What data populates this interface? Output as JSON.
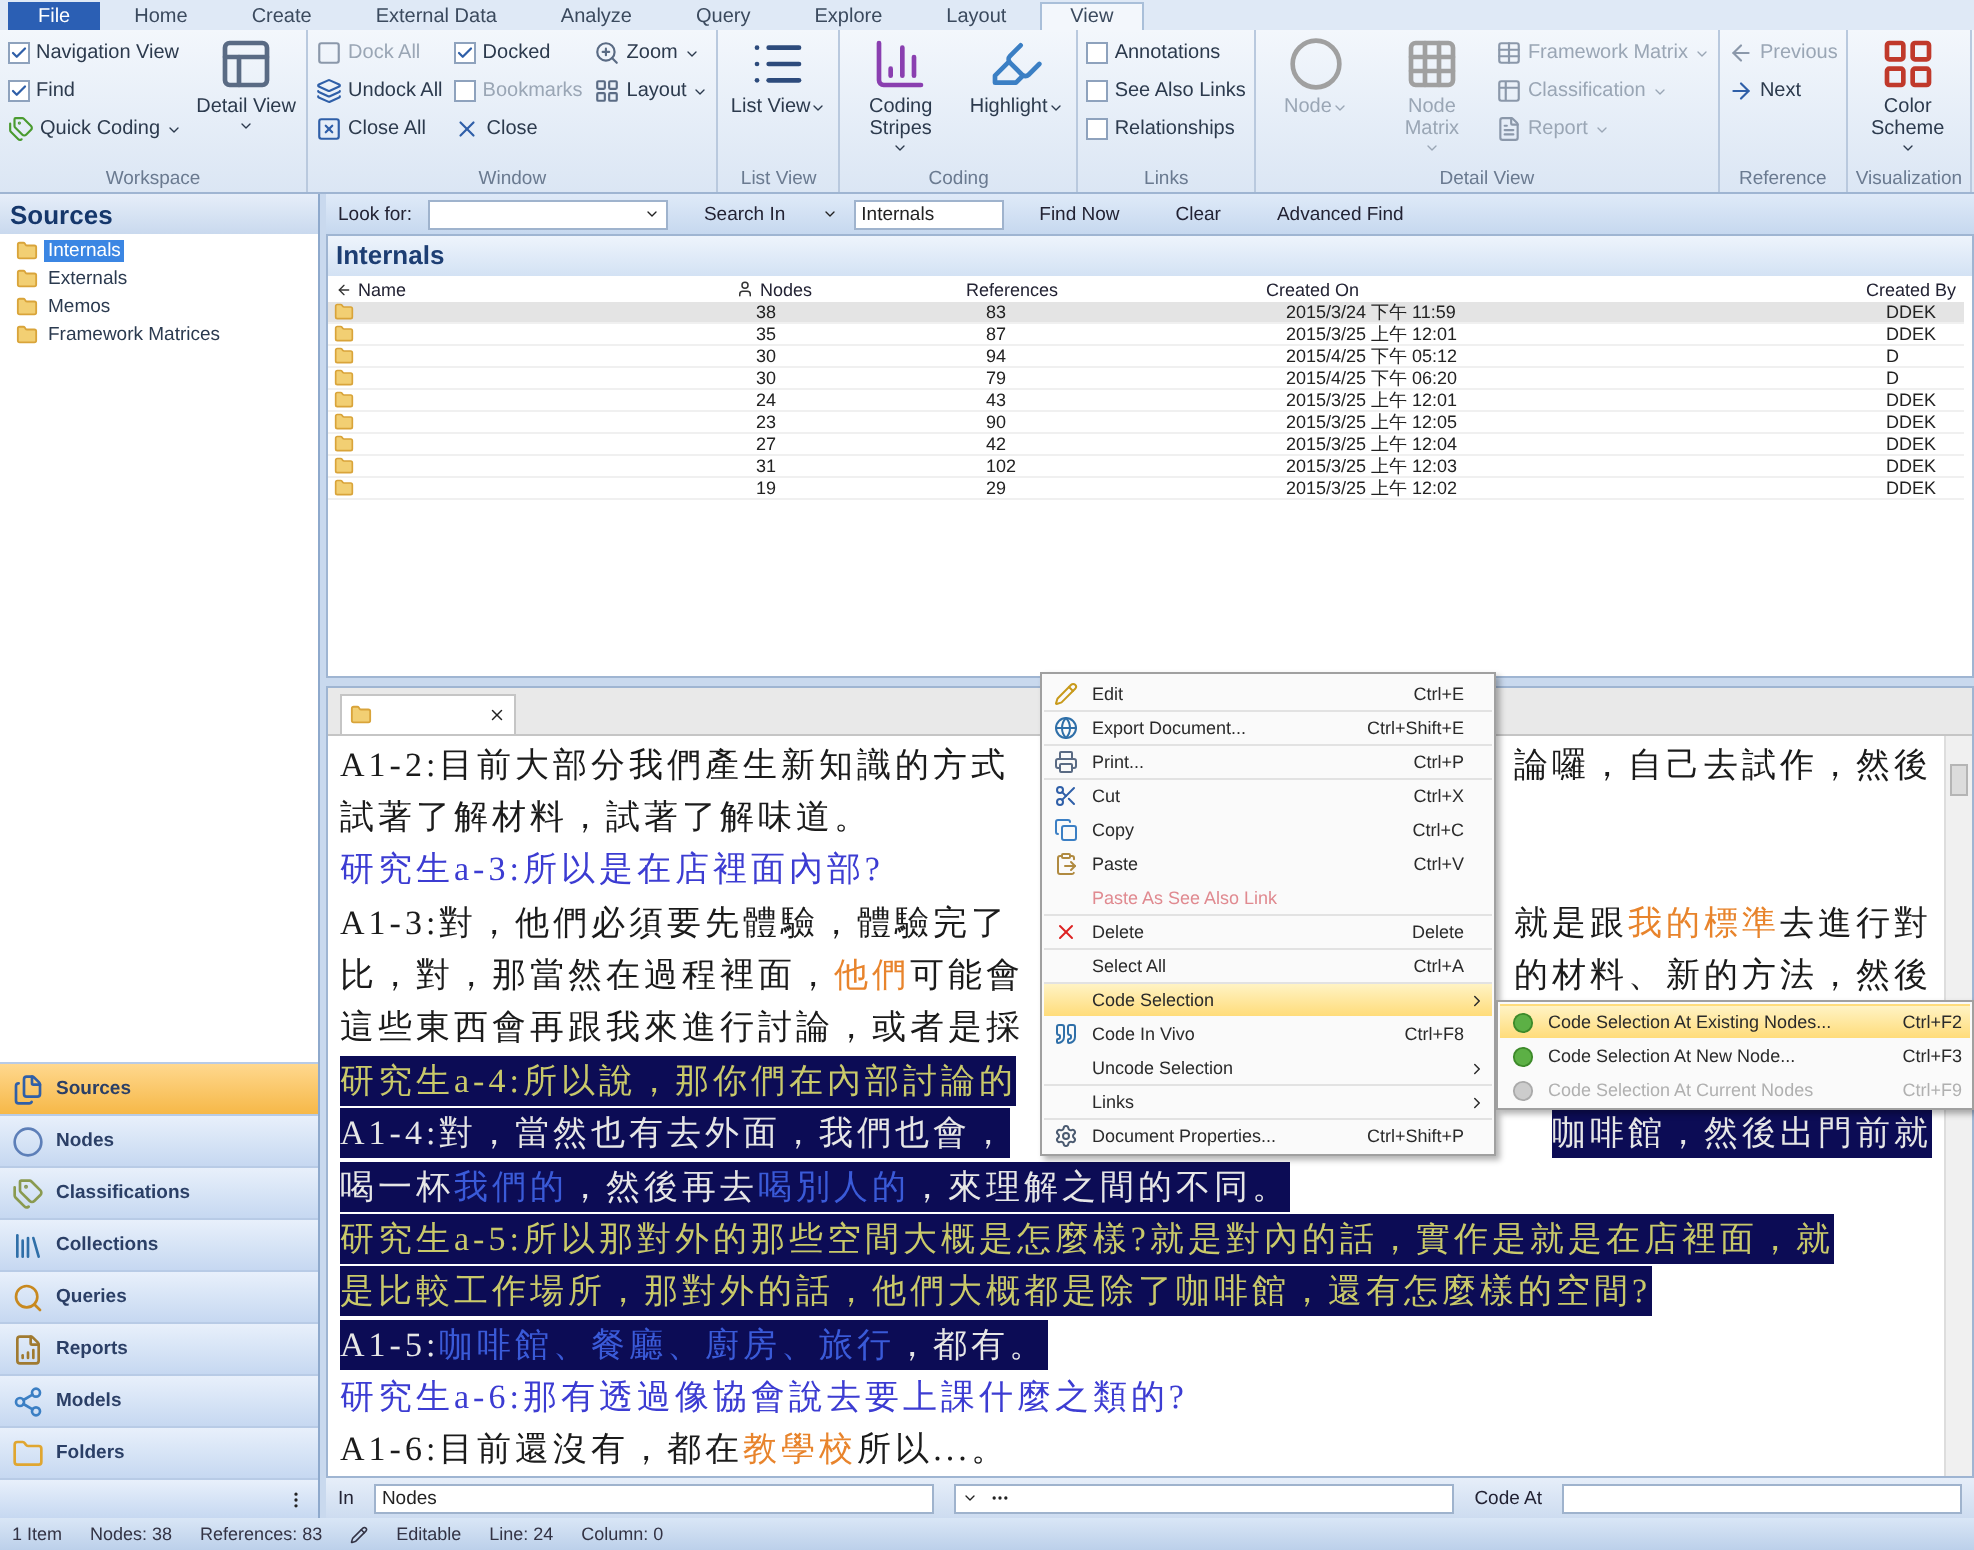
{
  "ribbon": {
    "tabs": [
      {
        "label": "File",
        "kind": "file",
        "selected": false
      },
      {
        "label": "Home",
        "kind": "tab",
        "selected": false
      },
      {
        "label": "Create",
        "kind": "tab",
        "selected": false
      },
      {
        "label": "External Data",
        "kind": "tab",
        "selected": false
      },
      {
        "label": "Analyze",
        "kind": "tab",
        "selected": false
      },
      {
        "label": "Query",
        "kind": "tab",
        "selected": false
      },
      {
        "label": "Explore",
        "kind": "tab",
        "selected": false
      },
      {
        "label": "Layout",
        "kind": "tab",
        "selected": false
      },
      {
        "label": "View",
        "kind": "tab",
        "selected": true
      }
    ],
    "groups": [
      {
        "label": "Workspace",
        "columns": [
          [
            {
              "kind": "check",
              "label": "Navigation View",
              "checked": true,
              "disabled": false
            },
            {
              "kind": "check",
              "label": "Find",
              "checked": true,
              "disabled": false
            },
            {
              "kind": "small",
              "label": "Quick Coding",
              "dropdown": true,
              "disabled": false
            }
          ],
          [
            {
              "kind": "large",
              "label": "Detail View",
              "dropdown": true,
              "disabled": false
            }
          ]
        ]
      },
      {
        "label": "Window",
        "columns": [
          [
            {
              "kind": "small",
              "label": "Dock All",
              "dropdown": false,
              "disabled": true
            },
            {
              "kind": "small",
              "label": "Undock All",
              "dropdown": false,
              "disabled": false
            },
            {
              "kind": "small",
              "label": "Close All",
              "dropdown": false,
              "disabled": false
            }
          ],
          [
            {
              "kind": "check",
              "label": "Docked",
              "checked": true,
              "disabled": false
            },
            {
              "kind": "check",
              "label": "Bookmarks",
              "checked": false,
              "disabled": true
            },
            {
              "kind": "small",
              "label": "Close",
              "dropdown": false,
              "disabled": false
            }
          ],
          [
            {
              "kind": "small",
              "label": "Zoom",
              "dropdown": true,
              "disabled": false
            },
            {
              "kind": "small",
              "label": "Layout",
              "dropdown": true,
              "disabled": false
            }
          ]
        ]
      },
      {
        "label": "List View",
        "columns": [
          [
            {
              "kind": "large",
              "label": "List View",
              "dropdown": true,
              "disabled": false
            }
          ]
        ]
      },
      {
        "label": "Coding",
        "columns": [
          [
            {
              "kind": "large",
              "label": "Coding Stripes",
              "dropdown": true,
              "disabled": false
            }
          ],
          [
            {
              "kind": "large",
              "label": "Highlight",
              "dropdown": true,
              "disabled": false
            }
          ]
        ]
      },
      {
        "label": "Links",
        "columns": [
          [
            {
              "kind": "check",
              "label": "Annotations",
              "checked": false,
              "disabled": false
            },
            {
              "kind": "check",
              "label": "See Also Links",
              "checked": false,
              "disabled": false
            },
            {
              "kind": "check",
              "label": "Relationships",
              "checked": false,
              "disabled": false
            }
          ]
        ]
      },
      {
        "label": "Detail View",
        "columns": [
          [
            {
              "kind": "large",
              "label": "Node",
              "dropdown": true,
              "disabled": true
            }
          ],
          [
            {
              "kind": "large",
              "label": "Node Matrix",
              "dropdown": true,
              "disabled": true
            }
          ],
          [
            {
              "kind": "small",
              "label": "Framework Matrix",
              "dropdown": true,
              "disabled": true
            },
            {
              "kind": "small",
              "label": "Classification",
              "dropdown": true,
              "disabled": true
            },
            {
              "kind": "small",
              "label": "Report",
              "dropdown": true,
              "disabled": true
            }
          ]
        ]
      },
      {
        "label": "Reference",
        "columns": [
          [
            {
              "kind": "small",
              "label": "Previous",
              "dropdown": false,
              "disabled": true
            },
            {
              "kind": "small",
              "label": "Next",
              "dropdown": false,
              "disabled": false
            }
          ]
        ]
      },
      {
        "label": "Visualization",
        "columns": [
          [
            {
              "kind": "large",
              "label": "Color Scheme",
              "dropdown": true,
              "disabled": false
            }
          ]
        ]
      }
    ]
  },
  "sidebar": {
    "title": "Sources",
    "tree": [
      {
        "label": "Internals",
        "selected": true
      },
      {
        "label": "Externals",
        "selected": false
      },
      {
        "label": "Memos",
        "selected": false
      },
      {
        "label": "Framework Matrices",
        "selected": false
      }
    ],
    "nav": [
      {
        "label": "Sources",
        "selected": true
      },
      {
        "label": "Nodes",
        "selected": false
      },
      {
        "label": "Classifications",
        "selected": false
      },
      {
        "label": "Collections",
        "selected": false
      },
      {
        "label": "Queries",
        "selected": false
      },
      {
        "label": "Reports",
        "selected": false
      },
      {
        "label": "Models",
        "selected": false
      },
      {
        "label": "Folders",
        "selected": false
      }
    ]
  },
  "find_bar": {
    "look_for_label": "Look for:",
    "search_in_label": "Search In",
    "search_in_value": "Internals",
    "buttons": [
      "Find Now",
      "Clear",
      "Advanced Find"
    ]
  },
  "table": {
    "title": "Internals",
    "columns": [
      "Name",
      "Nodes",
      "References",
      "Created On",
      "Created By"
    ],
    "rows": [
      {
        "nodes": "38",
        "references": "83",
        "created_on": "2015/3/24 下午 11:59",
        "created_by": "DDEK",
        "selected": true
      },
      {
        "nodes": "35",
        "references": "87",
        "created_on": "2015/3/25 上午 12:01",
        "created_by": "DDEK",
        "selected": false
      },
      {
        "nodes": "30",
        "references": "94",
        "created_on": "2015/4/25 下午 05:12",
        "created_by": "D",
        "selected": false
      },
      {
        "nodes": "30",
        "references": "79",
        "created_on": "2015/4/25 下午 06:20",
        "created_by": "D",
        "selected": false
      },
      {
        "nodes": "24",
        "references": "43",
        "created_on": "2015/3/25 上午 12:01",
        "created_by": "DDEK",
        "selected": false
      },
      {
        "nodes": "23",
        "references": "90",
        "created_on": "2015/3/25 上午 12:05",
        "created_by": "DDEK",
        "selected": false
      },
      {
        "nodes": "27",
        "references": "42",
        "created_on": "2015/3/25 上午 12:04",
        "created_by": "DDEK",
        "selected": false
      },
      {
        "nodes": "31",
        "references": "102",
        "created_on": "2015/3/25 上午 12:03",
        "created_by": "DDEK",
        "selected": false
      },
      {
        "nodes": "19",
        "references": "29",
        "created_on": "2015/3/25 上午 12:02",
        "created_by": "DDEK",
        "selected": false
      }
    ]
  },
  "document": {
    "lines": [
      {
        "kind": "answer",
        "selected": false,
        "left": [
          {
            "text": "A1-2:目前大部分我們產生新知識的方式",
            "marked": false
          }
        ],
        "right": [
          {
            "text": "論囉，自己去試作，然後",
            "marked": false
          }
        ]
      },
      {
        "kind": "answer",
        "selected": false,
        "left": [
          {
            "text": "試著了解材料，試著了解味道。",
            "marked": false
          }
        ]
      },
      {
        "kind": "question",
        "selected": false,
        "left": [
          {
            "text": "研究生a-3:所以是在店裡面內部?",
            "marked": false
          }
        ]
      },
      {
        "kind": "answer",
        "selected": false,
        "left": [
          {
            "text": "A1-3:對，他們必須要先體驗，體驗完了",
            "marked": false
          }
        ],
        "right": [
          {
            "text": "就是跟",
            "marked": false
          },
          {
            "text": "我的標準",
            "marked": true
          },
          {
            "text": "去進行對",
            "marked": false
          }
        ]
      },
      {
        "kind": "answer",
        "selected": false,
        "left": [
          {
            "text": "比，對，那當然在過程裡面，",
            "marked": false
          },
          {
            "text": "他們",
            "marked": true
          },
          {
            "text": "可能會",
            "marked": false
          }
        ],
        "right": [
          {
            "text": "的材料、新的方法，然後",
            "marked": false
          }
        ]
      },
      {
        "kind": "answer",
        "selected": false,
        "left": [
          {
            "text": "這些東西會再跟我來進行討論，或者是採",
            "marked": false
          }
        ]
      },
      {
        "kind": "question",
        "selected": true,
        "left": [
          {
            "text": "研究生a-4:所以說，那你們在內部討論的",
            "marked": false
          }
        ]
      },
      {
        "kind": "answer",
        "selected": true,
        "left": [
          {
            "text": "A1-4:對，當然也有去外面，我們也會，",
            "marked": false
          }
        ],
        "right": [
          {
            "text": "咖啡館，然後出門前就",
            "marked": false
          }
        ]
      },
      {
        "kind": "answer",
        "selected": true,
        "left": [
          {
            "text": "喝一杯",
            "marked": false
          },
          {
            "text": "我們的",
            "marked": true
          },
          {
            "text": "，然後再去",
            "marked": false
          },
          {
            "text": "喝別人的",
            "marked": true
          },
          {
            "text": "，來理解之間的不同。",
            "marked": false
          }
        ]
      },
      {
        "kind": "question",
        "selected": true,
        "left": [
          {
            "text": "研究生a-5:所以那對外的那些空間大概是怎麼樣?就是對內的話，實作是就是在店裡面，就",
            "marked": false
          }
        ]
      },
      {
        "kind": "question",
        "selected": true,
        "left": [
          {
            "text": "是比較工作場所，那對外的話，他們大概都是除了咖啡館，還有怎麼樣的空間?",
            "marked": false
          }
        ]
      },
      {
        "kind": "answer",
        "selected": true,
        "left": [
          {
            "text": "A1-5:",
            "marked": false
          },
          {
            "text": "咖啡館、餐廳、廚房、旅行",
            "marked": true
          },
          {
            "text": "，都有。",
            "marked": false
          }
        ]
      },
      {
        "kind": "question",
        "selected": false,
        "left": [
          {
            "text": "研究生a-6:那有透過像協會說去要上課什麼之類的?",
            "marked": false
          }
        ]
      },
      {
        "kind": "answer",
        "selected": false,
        "left": [
          {
            "text": "A1-6:目前還沒有，都在",
            "marked": false
          },
          {
            "text": "教學校",
            "marked": true
          },
          {
            "text": "所以...。",
            "marked": false
          }
        ]
      }
    ]
  },
  "context_menu": {
    "items": [
      {
        "label": "Edit",
        "shortcut": "Ctrl+E",
        "submenu": false,
        "disabled": false,
        "selected": false,
        "divider_above": false
      },
      {
        "label": "Export Document...",
        "shortcut": "Ctrl+Shift+E",
        "submenu": false,
        "disabled": false,
        "selected": false,
        "divider_above": true
      },
      {
        "label": "Print...",
        "shortcut": "Ctrl+P",
        "submenu": false,
        "disabled": false,
        "selected": false,
        "divider_above": true
      },
      {
        "label": "Cut",
        "shortcut": "Ctrl+X",
        "submenu": false,
        "disabled": false,
        "selected": false,
        "divider_above": true
      },
      {
        "label": "Copy",
        "shortcut": "Ctrl+C",
        "submenu": false,
        "disabled": false,
        "selected": false,
        "divider_above": false
      },
      {
        "label": "Paste",
        "shortcut": "Ctrl+V",
        "submenu": false,
        "disabled": false,
        "selected": false,
        "divider_above": false
      },
      {
        "label": "Paste As See Also Link",
        "submenu": false,
        "disabled": true,
        "selected": false,
        "divider_above": false
      },
      {
        "label": "Delete",
        "shortcut": "Delete",
        "submenu": false,
        "disabled": false,
        "selected": false,
        "divider_above": true
      },
      {
        "label": "Select All",
        "shortcut": "Ctrl+A",
        "submenu": false,
        "disabled": false,
        "selected": false,
        "divider_above": true
      },
      {
        "label": "Code Selection",
        "submenu": true,
        "disabled": false,
        "selected": true,
        "divider_above": true
      },
      {
        "label": "Code In Vivo",
        "shortcut": "Ctrl+F8",
        "submenu": false,
        "disabled": false,
        "selected": false,
        "divider_above": false
      },
      {
        "label": "Uncode Selection",
        "submenu": true,
        "disabled": false,
        "selected": false,
        "divider_above": false
      },
      {
        "label": "Links",
        "submenu": true,
        "disabled": false,
        "selected": false,
        "divider_above": true
      },
      {
        "label": "Document Properties...",
        "shortcut": "Ctrl+Shift+P",
        "submenu": false,
        "disabled": false,
        "selected": false,
        "divider_above": true
      }
    ]
  },
  "submenu": {
    "items": [
      {
        "label": "Code Selection At Existing Nodes...",
        "shortcut": "Ctrl+F2",
        "disabled": false,
        "selected": true
      },
      {
        "label": "Code Selection At New Node...",
        "shortcut": "Ctrl+F3",
        "disabled": false,
        "selected": false
      },
      {
        "label": "Code Selection At Current Nodes",
        "shortcut": "Ctrl+F9",
        "disabled": true,
        "selected": false
      }
    ]
  },
  "code_bar": {
    "in_label": "In",
    "in_value": "Nodes",
    "code_at_label": "Code At"
  },
  "status_bar": {
    "left": [
      "1 Item",
      "Nodes: 38",
      "References: 83"
    ],
    "right": [
      "Editable",
      "Line: 24",
      "Column: 0"
    ]
  }
}
